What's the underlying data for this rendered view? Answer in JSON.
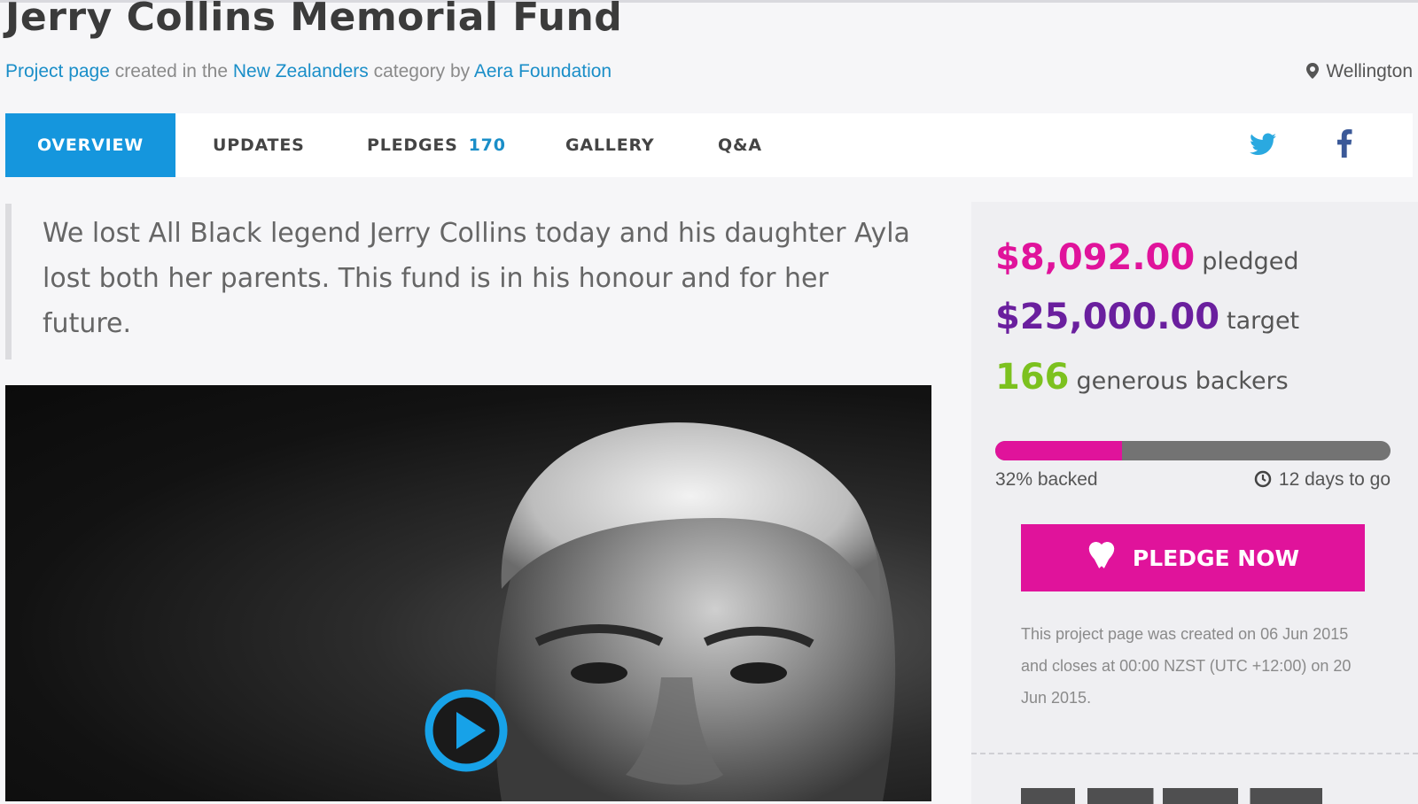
{
  "page": {
    "title": "Jerry Collins Memorial Fund",
    "byline": {
      "project_link": "Project page",
      "text1": " created in the ",
      "category_link": "New Zealanders",
      "text2": " category by ",
      "author_link": "Aera Foundation"
    },
    "location": "Wellington"
  },
  "tabs": [
    {
      "label": "OVERVIEW",
      "active": true
    },
    {
      "label": "UPDATES"
    },
    {
      "label": "PLEDGES",
      "count": "170"
    },
    {
      "label": "GALLERY"
    },
    {
      "label": "Q&A"
    }
  ],
  "social": {
    "twitter_icon": "twitter-icon",
    "facebook_icon": "facebook-icon",
    "twitter_color": "#2aa9e0",
    "facebook_color": "#3b5998"
  },
  "blurb": "We lost All Black legend Jerry Collins today and his daughter Ayla lost both her parents. This fund is in his honour and for her future.",
  "video": {
    "play_icon": "play-icon"
  },
  "stats": {
    "pledged": {
      "value": "$8,092.00",
      "label": "pledged",
      "color": "#e0139b"
    },
    "target": {
      "value": "$25,000.00",
      "label": "target",
      "color": "#6a1f9e"
    },
    "backers": {
      "value": "166",
      "label": "generous backers",
      "color": "#7cc11f"
    }
  },
  "progress": {
    "percent": 32,
    "backed_label": "32% backed",
    "days_label": "12 days to go"
  },
  "pledge_button": {
    "label": "PLEDGE NOW",
    "icon": "heart-icon",
    "color": "#e0139b"
  },
  "note": "This project page was created on 06 Jun 2015 and closes at 00:00 NZST (UTC +12:00) on 20 Jun 2015."
}
